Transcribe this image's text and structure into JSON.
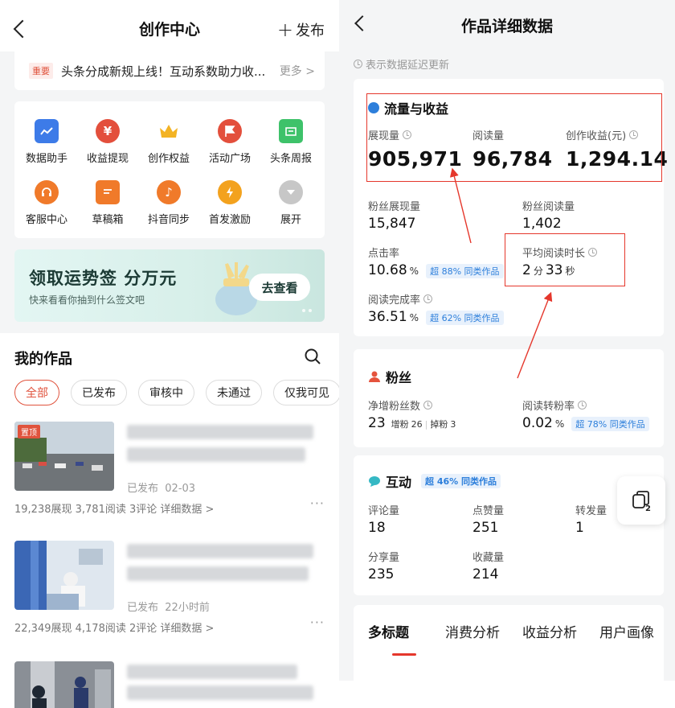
{
  "left": {
    "title": "创作中心",
    "publish_label": "发布",
    "notice": {
      "tag": "重要",
      "text": "头条分成新规上线！互动系数助力收...",
      "more": "更多 >"
    },
    "grid": [
      {
        "label": "数据助手",
        "icon": "chart-icon",
        "color": "#3d7be8"
      },
      {
        "label": "收益提现",
        "icon": "yen-icon",
        "color": "#e34f3c"
      },
      {
        "label": "创作权益",
        "icon": "crown-icon",
        "color": "#f3b324"
      },
      {
        "label": "活动广场",
        "icon": "flag-icon",
        "color": "#e34f3c"
      },
      {
        "label": "头条周报",
        "icon": "calendar-icon",
        "color": "#3ec26a"
      },
      {
        "label": "客服中心",
        "icon": "headset-icon",
        "color": "#f07a2a"
      },
      {
        "label": "草稿箱",
        "icon": "draft-icon",
        "color": "#f07a2a"
      },
      {
        "label": "抖音同步",
        "icon": "douyin-icon",
        "color": "#f07a2a"
      },
      {
        "label": "首发激励",
        "icon": "bolt-icon",
        "color": "#f3a21e"
      },
      {
        "label": "展开",
        "icon": "expand-icon",
        "color": "#c7c7c7"
      }
    ],
    "banner": {
      "title": "领取运势签 分万元",
      "subtitle": "快来看看你抽到什么签文吧",
      "button": "去查看"
    },
    "works_title": "我的作品",
    "filters": [
      "全部",
      "已发布",
      "审核中",
      "未通过",
      "仅我可见"
    ],
    "works": [
      {
        "tag": "置顶",
        "status": "已发布",
        "time": "02-03",
        "stats": "19,238展现  3,781阅读  3评论  详细数据 >"
      },
      {
        "tag": "",
        "status": "已发布",
        "time": "22小时前",
        "stats": "22,349展现  4,178阅读  2评论  详细数据 >"
      },
      {
        "tag": "",
        "status": "",
        "time": "",
        "stats": ""
      }
    ],
    "more_dots": "···"
  },
  "right": {
    "title": "作品详细数据",
    "delay_note": "表示数据延迟更新",
    "traffic": {
      "title": "流量与收益",
      "impressions_label": "展现量",
      "impressions": "905,971",
      "reads_label": "阅读量",
      "reads": "96,784",
      "income_label": "创作收益(元)",
      "income": "1,294.14",
      "fan_impr_label": "粉丝展现量",
      "fan_impr": "15,847",
      "fan_reads_label": "粉丝阅读量",
      "fan_reads": "1,402",
      "ctr_label": "点击率",
      "ctr": "10.68",
      "ctr_unit": "%",
      "ctr_badge": "超 88% 同类作品",
      "avg_time_label": "平均阅读时长",
      "avg_time_min": "2",
      "avg_time_min_unit": "分",
      "avg_time_sec": "33",
      "avg_time_sec_unit": "秒",
      "completion_label": "阅读完成率",
      "completion": "36.51",
      "completion_unit": "%",
      "completion_badge": "超 62% 同类作品"
    },
    "fans": {
      "title": "粉丝",
      "net_label": "净增粉丝数",
      "net": "23",
      "gain_label": "增粉",
      "gain": "26",
      "loss_label": "掉粉",
      "loss": "3",
      "conv_label": "阅读转粉率",
      "conv": "0.02",
      "conv_unit": "%",
      "conv_badge": "超 78% 同类作品"
    },
    "interaction": {
      "title": "互动",
      "badge": "超 46% 同类作品",
      "comments_label": "评论量",
      "comments": "18",
      "likes_label": "点赞量",
      "likes": "251",
      "reposts_label": "转发量",
      "reposts": "1",
      "shares_label": "分享量",
      "shares": "235",
      "favorites_label": "收藏量",
      "favorites": "214"
    },
    "tabs": [
      "多标题",
      "消费分析",
      "收益分析",
      "用户画像"
    ],
    "float_count": "2"
  },
  "colors": {
    "accent_red": "#e5372c",
    "badge_blue": "#2d7fdb"
  }
}
